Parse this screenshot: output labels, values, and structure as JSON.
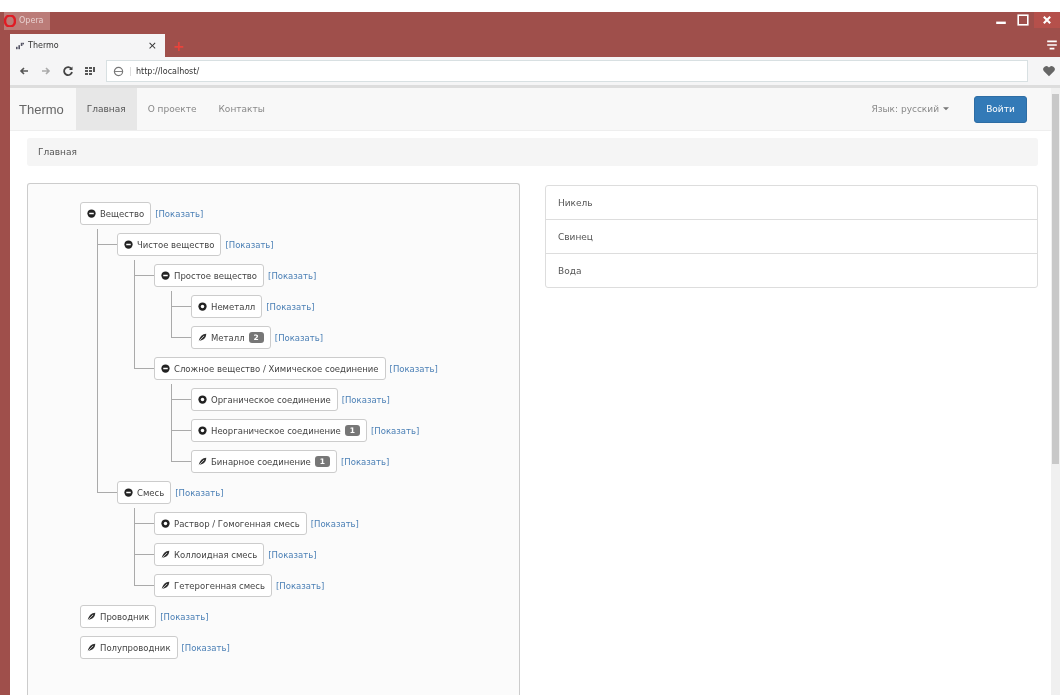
{
  "browser": {
    "app_label": "Opera",
    "tabs": [
      {
        "title": "Thermo",
        "close": "×",
        "selected": true
      }
    ],
    "new_tab": "+",
    "address": "http://localhost/"
  },
  "navbar": {
    "brand": "Thermo",
    "links": [
      {
        "label": "Главная",
        "selected": true
      },
      {
        "label": "О проекте",
        "selected": false
      },
      {
        "label": "Контакты",
        "selected": false
      }
    ],
    "language": "Язык: русский",
    "login": "Войти"
  },
  "breadcrumb": "Главная",
  "tree": [
    {
      "label": "Вещество",
      "kind": "expanded",
      "link": "[Показать]",
      "children": [
        {
          "label": "Чистое вещество",
          "kind": "expanded",
          "link": "[Показать]",
          "children": [
            {
              "label": "Простое вещество",
              "kind": "expanded",
              "link": "[Показать]",
              "children": [
                {
                  "label": "Неметалл",
                  "kind": "collapsed",
                  "link": "[Показать]"
                },
                {
                  "label": "Металл",
                  "kind": "leaf",
                  "badge": "2",
                  "link": "[Показать]"
                }
              ]
            },
            {
              "label": "Сложное вещество / Химическое соединение",
              "kind": "expanded",
              "link": "[Показать]",
              "children": [
                {
                  "label": "Органическое соединение",
                  "kind": "collapsed",
                  "link": "[Показать]"
                },
                {
                  "label": "Неорганическое соединение",
                  "kind": "collapsed",
                  "badge": "1",
                  "link": "[Показать]"
                },
                {
                  "label": "Бинарное соединение",
                  "kind": "leaf",
                  "badge": "1",
                  "link": "[Показать]"
                }
              ]
            }
          ]
        },
        {
          "label": "Смесь",
          "kind": "expanded",
          "link": "[Показать]",
          "children": [
            {
              "label": "Раствор / Гомогенная смесь",
              "kind": "collapsed",
              "link": "[Показать]"
            },
            {
              "label": "Коллоидная смесь",
              "kind": "leaf",
              "link": "[Показать]"
            },
            {
              "label": "Гетерогенная смесь",
              "kind": "leaf",
              "link": "[Показать]"
            }
          ]
        }
      ]
    },
    {
      "label": "Проводник",
      "kind": "leaf",
      "link": "[Показать]"
    },
    {
      "label": "Полупроводник",
      "kind": "leaf",
      "link": "[Показать]"
    }
  ],
  "items": [
    {
      "label": "Никель"
    },
    {
      "label": "Свинец"
    },
    {
      "label": "Вода"
    }
  ]
}
